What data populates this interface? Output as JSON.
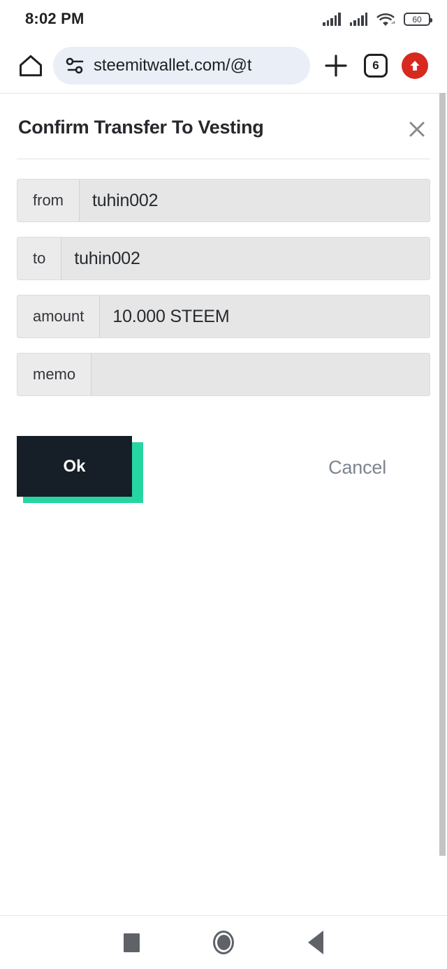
{
  "status_bar": {
    "clock": "8:02 PM",
    "signal_1_icon": "signal-bars-icon",
    "signal_2_icon": "signal-bars-icon",
    "wifi_icon": "wifi-icon",
    "battery_level": "60",
    "battery_icon": "battery-icon"
  },
  "browser": {
    "home_icon": "home-icon",
    "site_settings_icon": "tune-sliders-icon",
    "url": "steemitwallet.com/@t",
    "new_tab_icon": "plus-icon",
    "tab_count": "6",
    "update_icon": "upload-arrow-icon"
  },
  "dialog": {
    "title": "Confirm Transfer To Vesting",
    "close_icon": "close-x-icon",
    "fields": [
      {
        "label": "from",
        "value": "tuhin002"
      },
      {
        "label": "to",
        "value": "tuhin002"
      },
      {
        "label": "amount",
        "value": "10.000 STEEM"
      },
      {
        "label": "memo",
        "value": ""
      }
    ],
    "ok_label": "Ok",
    "cancel_label": "Cancel",
    "ok_button_color": "#161e27",
    "ok_shadow_color": "#26d6a2",
    "cancel_text_color": "#7d858e"
  },
  "nav_bar": {
    "recents_icon": "square-recents-icon",
    "home_icon": "circle-home-icon",
    "back_icon": "triangle-back-icon"
  }
}
